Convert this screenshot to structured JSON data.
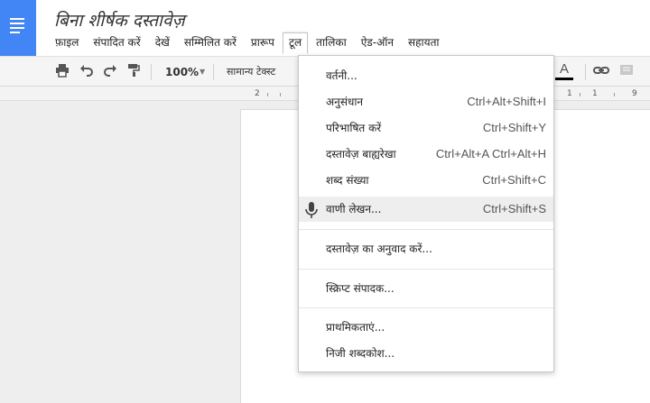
{
  "document": {
    "title": "बिना शीर्षक दस्तावेज़"
  },
  "menubar": {
    "items": [
      {
        "label": "फ़ाइल"
      },
      {
        "label": "संपादित करें"
      },
      {
        "label": "देखें"
      },
      {
        "label": "सम्मिलित करें"
      },
      {
        "label": "प्रारूप"
      },
      {
        "label": "टूल"
      },
      {
        "label": "तालिका"
      },
      {
        "label": "ऐड-ऑन"
      },
      {
        "label": "सहायता"
      }
    ],
    "active_item": "टूल"
  },
  "toolbar": {
    "zoom": "100%",
    "style": "सामान्य टेक्स्ट",
    "text_color_label": "A",
    "icons": [
      "print-icon",
      "undo-icon",
      "redo-icon",
      "paint-format-icon",
      "link-icon",
      "comment-icon"
    ]
  },
  "ruler": {
    "ticks": [
      "2",
      "1",
      "1",
      "9"
    ]
  },
  "tools_menu": {
    "items": [
      {
        "label": "वर्तनी...",
        "shortcut": ""
      },
      {
        "label": "अनुसंधान",
        "shortcut": "Ctrl+Alt+Shift+I"
      },
      {
        "label": "परिभाषित करें",
        "shortcut": "Ctrl+Shift+Y"
      },
      {
        "label": "दस्तावेज़ बाह्यरेखा",
        "shortcut": "Ctrl+Alt+A Ctrl+Alt+H"
      },
      {
        "label": "शब्द संख्या",
        "shortcut": "Ctrl+Shift+C"
      },
      {
        "label": "वाणी लेखन...",
        "shortcut": "Ctrl+Shift+S",
        "icon": "microphone-icon",
        "highlighted": true
      },
      {
        "label": "दस्तावेज़ का अनुवाद करें...",
        "shortcut": ""
      },
      {
        "label": "स्क्रिप्ट संपादक...",
        "shortcut": ""
      },
      {
        "label": "प्राथमिकताएं...",
        "shortcut": ""
      },
      {
        "label": "निजी शब्दकोश...",
        "shortcut": ""
      }
    ]
  }
}
